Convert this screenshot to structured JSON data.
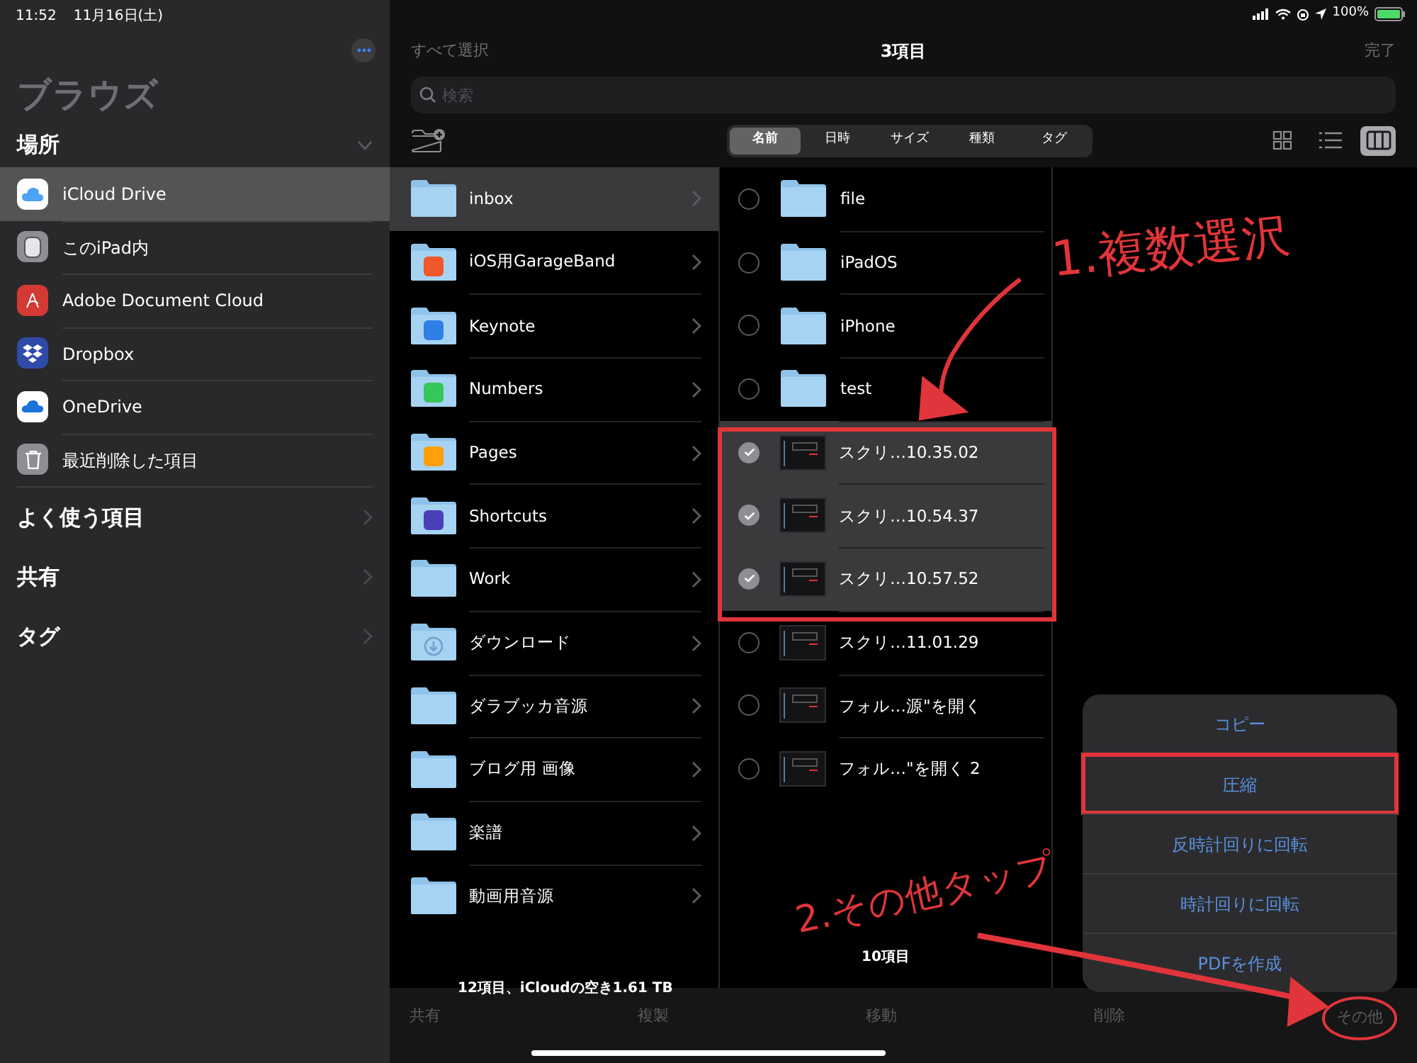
{
  "status_bar": {
    "time": "11:52",
    "date": "11月16日(土)",
    "battery": "100%"
  },
  "sidebar": {
    "title": "ブラウズ",
    "section": "場所",
    "expanded": true,
    "locations": [
      {
        "label": "iCloud Drive",
        "kind": "icloud",
        "selected": true
      },
      {
        "label": "このiPad内",
        "kind": "ipad",
        "selected": false
      },
      {
        "label": "Adobe Document Cloud",
        "kind": "adobe",
        "selected": false
      },
      {
        "label": "Dropbox",
        "kind": "dropbox",
        "selected": false
      },
      {
        "label": "OneDrive",
        "kind": "onedrive",
        "selected": false
      },
      {
        "label": "最近削除した項目",
        "kind": "trash",
        "selected": false
      }
    ],
    "sections": [
      "よく使う項目",
      "共有",
      "タグ"
    ]
  },
  "nav": {
    "select_all": "すべて選択",
    "title": "3項目",
    "done": "完了"
  },
  "search": {
    "placeholder": "検索"
  },
  "sort_tabs": [
    {
      "label": "名前",
      "selected": true
    },
    {
      "label": "日時",
      "selected": false
    },
    {
      "label": "サイズ",
      "selected": false
    },
    {
      "label": "種類",
      "selected": false
    },
    {
      "label": "タグ",
      "selected": false
    }
  ],
  "view_buttons": [
    {
      "kind": "grid",
      "selected": false
    },
    {
      "kind": "list",
      "selected": false
    },
    {
      "kind": "columns",
      "selected": true
    }
  ],
  "column_1": {
    "items": [
      {
        "name": "inbox",
        "kind": "folder",
        "selected": true
      },
      {
        "name": "iOS用GarageBand",
        "kind": "app",
        "color": "#f0572a",
        "selected": false
      },
      {
        "name": "Keynote",
        "kind": "app",
        "color": "#2f7fe6",
        "selected": false
      },
      {
        "name": "Numbers",
        "kind": "app",
        "color": "#34c759",
        "selected": false
      },
      {
        "name": "Pages",
        "kind": "app",
        "color": "#ff9f0a",
        "selected": false
      },
      {
        "name": "Shortcuts",
        "kind": "app",
        "color": "#4b3fb8",
        "selected": false
      },
      {
        "name": "Work",
        "kind": "folder",
        "selected": false
      },
      {
        "name": "ダウンロード",
        "kind": "download",
        "selected": false
      },
      {
        "name": "ダラブッカ音源",
        "kind": "folder",
        "selected": false
      },
      {
        "name": "ブログ用 画像",
        "kind": "folder",
        "selected": false
      },
      {
        "name": "楽譜",
        "kind": "folder",
        "selected": false
      },
      {
        "name": "動画用音源",
        "kind": "folder",
        "selected": false
      }
    ],
    "footer": "12項目、iCloudの空き1.61 TB"
  },
  "column_2": {
    "items": [
      {
        "name": "file",
        "kind": "folder",
        "checked": false
      },
      {
        "name": "iPadOS",
        "kind": "folder",
        "checked": false
      },
      {
        "name": "iPhone",
        "kind": "folder",
        "checked": false
      },
      {
        "name": "test",
        "kind": "folder",
        "checked": false
      },
      {
        "name": "スクリ…10.35.02",
        "kind": "image",
        "checked": true
      },
      {
        "name": "スクリ…10.54.37",
        "kind": "image",
        "checked": true
      },
      {
        "name": "スクリ…10.57.52",
        "kind": "image",
        "checked": true
      },
      {
        "name": "スクリ…11.01.29",
        "kind": "image",
        "checked": false
      },
      {
        "name": "フォル…源\"を開く",
        "kind": "image",
        "checked": false
      },
      {
        "name": "フォル…\"を開く 2",
        "kind": "image",
        "checked": false
      }
    ],
    "footer": "10項目"
  },
  "menu": [
    {
      "label": "コピー",
      "annotated": false
    },
    {
      "label": "圧縮",
      "annotated": true
    },
    {
      "label": "反時計回りに回転",
      "annotated": false
    },
    {
      "label": "時計回りに回転",
      "annotated": false
    },
    {
      "label": "PDFを作成",
      "annotated": false
    }
  ],
  "toolbar": [
    {
      "label": "共有",
      "annotated": false
    },
    {
      "label": "複製",
      "annotated": false
    },
    {
      "label": "移動",
      "annotated": false
    },
    {
      "label": "削除",
      "annotated": false
    },
    {
      "label": "その他",
      "annotated": true
    }
  ],
  "annotations": [
    "1.複数選沢",
    "2.その他タップ"
  ]
}
